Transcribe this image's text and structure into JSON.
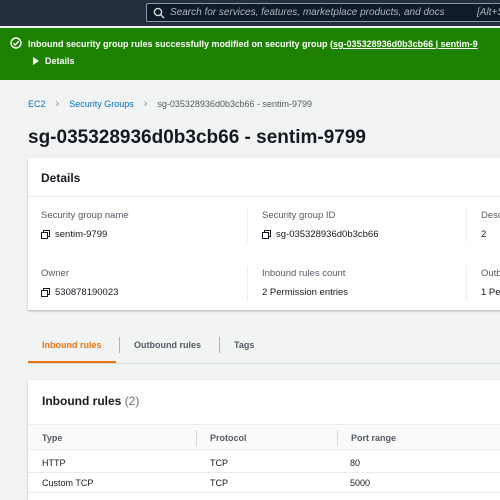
{
  "topnav": {
    "search_placeholder": "Search for services, features, marketplace products, and docs",
    "shortcut": "[Alt+S]"
  },
  "flash": {
    "message_prefix": "Inbound security group rules successfully modified on security group (",
    "message_link": "sg-035328936d0b3cb66 | sentim-9",
    "details_label": "Details",
    "color": "#1d8102"
  },
  "breadcrumb": {
    "items": [
      "EC2",
      "Security Groups",
      "sg-035328936d0b3cb66 - sentim-9799"
    ]
  },
  "page": {
    "title": "sg-035328936d0b3cb66 - sentim-9799"
  },
  "details": {
    "header": "Details",
    "fields": {
      "sg_name_label": "Security group name",
      "sg_name_value": "sentim-9799",
      "sg_id_label": "Security group ID",
      "sg_id_value": "sg-035328936d0b3cb66",
      "desc_label": "Desc",
      "desc_value": "2",
      "owner_label": "Owner",
      "owner_value": "530878190023",
      "inbound_count_label": "Inbound rules count",
      "inbound_count_value": "2 Permission entries",
      "outbound_label": "Outb",
      "outbound_value": "1 Pe"
    }
  },
  "tabs": [
    {
      "label": "Inbound rules",
      "active": true
    },
    {
      "label": "Outbound rules",
      "active": false
    },
    {
      "label": "Tags",
      "active": false
    }
  ],
  "inbound": {
    "title": "Inbound rules",
    "count": "(2)",
    "columns": [
      "Type",
      "Protocol",
      "Port range"
    ],
    "rows": [
      {
        "type": "HTTP",
        "protocol": "TCP",
        "port": "80"
      },
      {
        "type": "Custom TCP",
        "protocol": "TCP",
        "port": "5000"
      }
    ]
  },
  "colors": {
    "accent": "#ec7211",
    "link": "#0073bb",
    "nav": "#232f3e"
  }
}
